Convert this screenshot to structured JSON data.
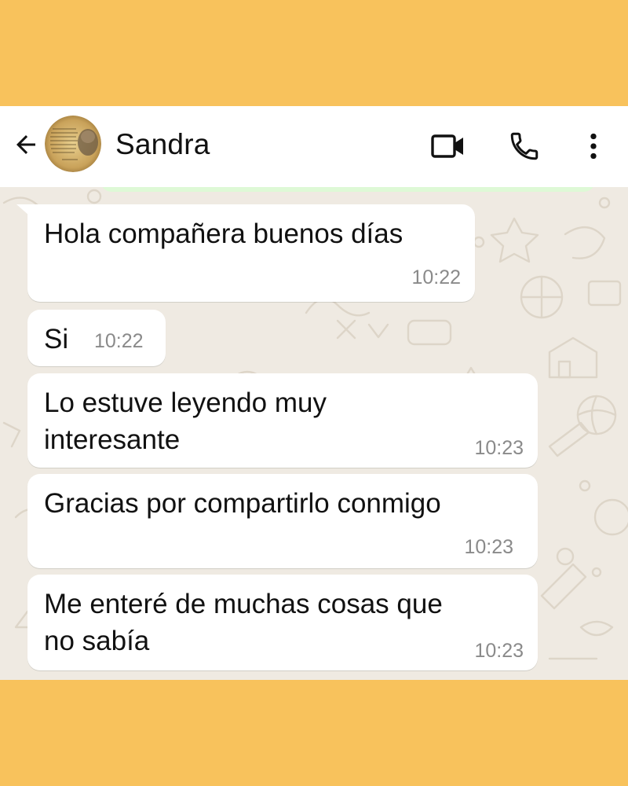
{
  "header": {
    "contact_name": "Sandra"
  },
  "icons": {
    "back": "arrow-left-icon",
    "video": "video-camera-icon",
    "call": "phone-icon",
    "menu": "more-vert-icon"
  },
  "colors": {
    "page_background": "#F8C25C",
    "header_background": "#FFFFFF",
    "chat_background": "#EFEAE2",
    "bubble_incoming": "#FFFFFF",
    "timestamp": "#8A8A8A"
  },
  "messages": [
    {
      "lines": [
        "Hola compañera buenos días"
      ],
      "time": "10:22"
    },
    {
      "lines": [
        "Si"
      ],
      "time": "10:22"
    },
    {
      "lines": [
        "Lo estuve leyendo muy",
        "interesante"
      ],
      "time": "10:23"
    },
    {
      "lines": [
        "Gracias por compartirlo conmigo"
      ],
      "time": "10:23"
    },
    {
      "lines": [
        "Me enteré de muchas cosas que",
        "no sabía"
      ],
      "time": "10:23"
    }
  ]
}
